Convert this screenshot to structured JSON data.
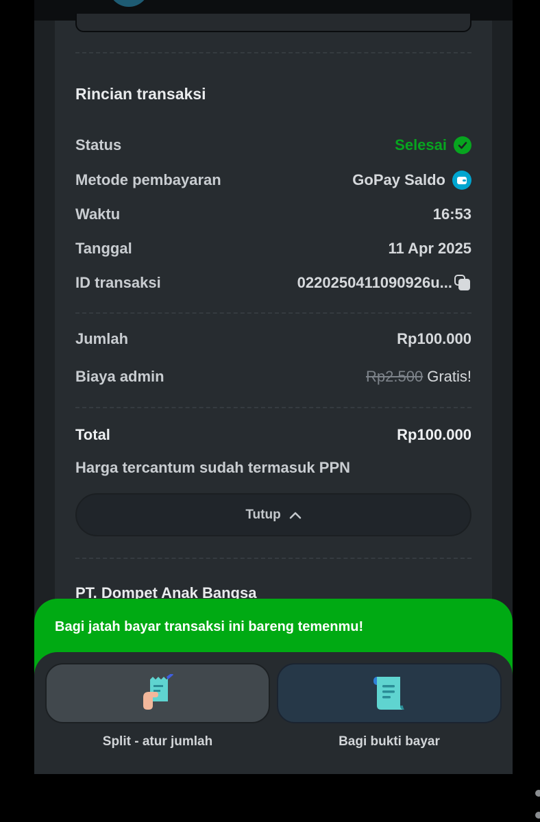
{
  "details": {
    "title": "Rincian transaksi",
    "rows": [
      {
        "label": "Status",
        "value": "Selesai"
      },
      {
        "label": "Metode pembayaran",
        "value": "GoPay Saldo"
      },
      {
        "label": "Waktu",
        "value": "16:53"
      },
      {
        "label": "Tanggal",
        "value": "11 Apr 2025"
      },
      {
        "label": "ID transaksi",
        "value": "0220250411090926u..."
      }
    ],
    "amount": {
      "label": "Jumlah",
      "value": "Rp100.000"
    },
    "admin_fee": {
      "label": "Biaya admin",
      "original": "Rp2.500",
      "value": "Gratis!"
    },
    "total": {
      "label": "Total",
      "value": "Rp100.000"
    },
    "note": "Harga tercantum sudah termasuk PPN",
    "close_label": "Tutup"
  },
  "company": "PT. Dompet Anak Bangsa",
  "split_sheet": {
    "banner": "Bagi jatah bayar transaksi ini bareng temenmu!",
    "options": [
      {
        "label": "Split - atur jumlah",
        "icon": "receipt-hand-icon"
      },
      {
        "label": "Bagi bukti bayar",
        "icon": "receipt-scroll-icon"
      }
    ]
  },
  "colors": {
    "success": "#07a51f",
    "gopay": "#00a5cf",
    "banner": "#00aa13"
  }
}
